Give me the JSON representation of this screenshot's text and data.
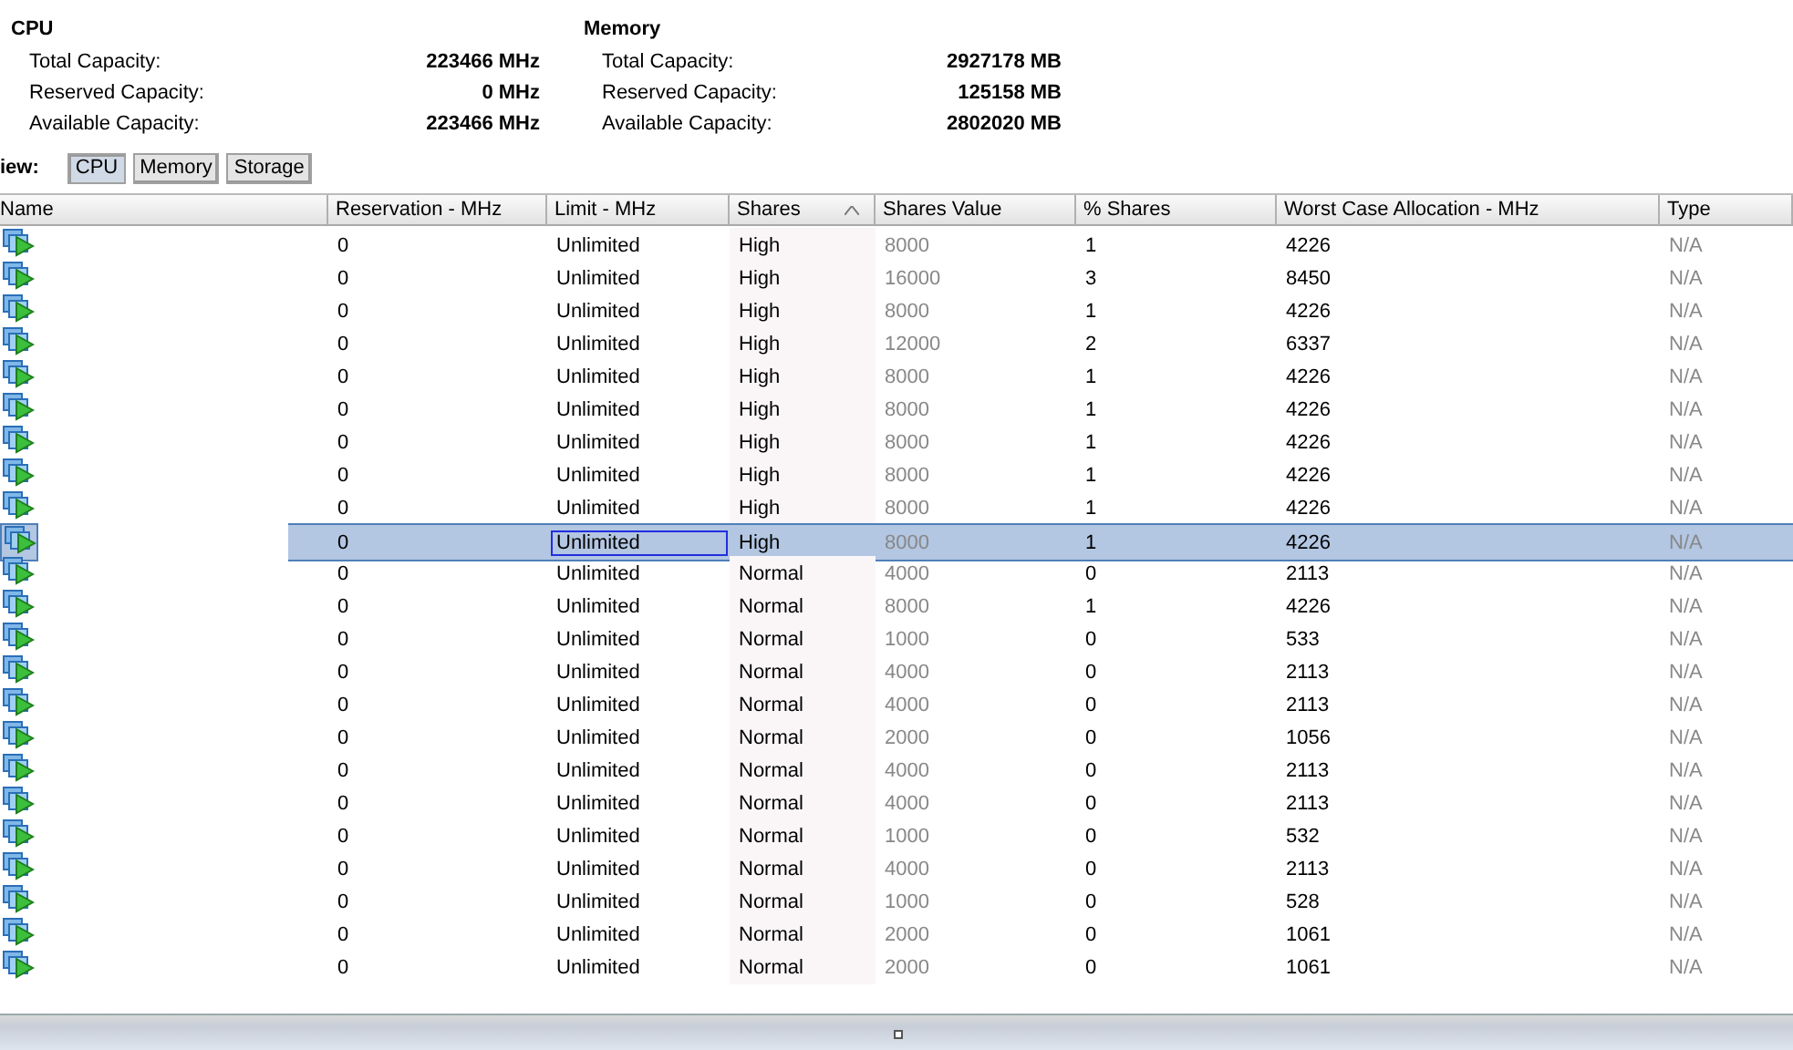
{
  "cpu": {
    "title": "CPU",
    "rows": [
      {
        "label": "Total Capacity:",
        "value": "223466 MHz"
      },
      {
        "label": "Reserved Capacity:",
        "value": "0 MHz"
      },
      {
        "label": "Available Capacity:",
        "value": "223466 MHz"
      }
    ]
  },
  "memory": {
    "title": "Memory",
    "rows": [
      {
        "label": "Total Capacity:",
        "value": "2927178 MB"
      },
      {
        "label": "Reserved Capacity:",
        "value": "125158 MB"
      },
      {
        "label": "Available Capacity:",
        "value": "2802020 MB"
      }
    ]
  },
  "view": {
    "label": "iew:",
    "buttons": [
      {
        "label": "CPU",
        "selected": true
      },
      {
        "label": "Memory",
        "selected": false
      },
      {
        "label": "Storage",
        "selected": false
      }
    ]
  },
  "table": {
    "columns": [
      {
        "label": "Name",
        "sorted": false
      },
      {
        "label": "Reservation - MHz",
        "sorted": false
      },
      {
        "label": "Limit - MHz",
        "sorted": false
      },
      {
        "label": "Shares",
        "sorted": true
      },
      {
        "label": "Shares Value",
        "sorted": false
      },
      {
        "label": "% Shares",
        "sorted": false
      },
      {
        "label": "Worst Case Allocation - MHz",
        "sorted": false
      },
      {
        "label": "Type",
        "sorted": false
      }
    ],
    "rows": [
      {
        "reservation": "0",
        "limit": "Unlimited",
        "shares": "High",
        "shares_value": "8000",
        "percent_shares": "1",
        "worst_case": "4226",
        "type": "N/A",
        "selected": false
      },
      {
        "reservation": "0",
        "limit": "Unlimited",
        "shares": "High",
        "shares_value": "16000",
        "percent_shares": "3",
        "worst_case": "8450",
        "type": "N/A",
        "selected": false
      },
      {
        "reservation": "0",
        "limit": "Unlimited",
        "shares": "High",
        "shares_value": "8000",
        "percent_shares": "1",
        "worst_case": "4226",
        "type": "N/A",
        "selected": false
      },
      {
        "reservation": "0",
        "limit": "Unlimited",
        "shares": "High",
        "shares_value": "12000",
        "percent_shares": "2",
        "worst_case": "6337",
        "type": "N/A",
        "selected": false
      },
      {
        "reservation": "0",
        "limit": "Unlimited",
        "shares": "High",
        "shares_value": "8000",
        "percent_shares": "1",
        "worst_case": "4226",
        "type": "N/A",
        "selected": false
      },
      {
        "reservation": "0",
        "limit": "Unlimited",
        "shares": "High",
        "shares_value": "8000",
        "percent_shares": "1",
        "worst_case": "4226",
        "type": "N/A",
        "selected": false
      },
      {
        "reservation": "0",
        "limit": "Unlimited",
        "shares": "High",
        "shares_value": "8000",
        "percent_shares": "1",
        "worst_case": "4226",
        "type": "N/A",
        "selected": false
      },
      {
        "reservation": "0",
        "limit": "Unlimited",
        "shares": "High",
        "shares_value": "8000",
        "percent_shares": "1",
        "worst_case": "4226",
        "type": "N/A",
        "selected": false
      },
      {
        "reservation": "0",
        "limit": "Unlimited",
        "shares": "High",
        "shares_value": "8000",
        "percent_shares": "1",
        "worst_case": "4226",
        "type": "N/A",
        "selected": false
      },
      {
        "reservation": "0",
        "limit": "Unlimited",
        "shares": "High",
        "shares_value": "8000",
        "percent_shares": "1",
        "worst_case": "4226",
        "type": "N/A",
        "selected": true
      },
      {
        "reservation": "0",
        "limit": "Unlimited",
        "shares": "Normal",
        "shares_value": "4000",
        "percent_shares": "0",
        "worst_case": "2113",
        "type": "N/A",
        "selected": false
      },
      {
        "reservation": "0",
        "limit": "Unlimited",
        "shares": "Normal",
        "shares_value": "8000",
        "percent_shares": "1",
        "worst_case": "4226",
        "type": "N/A",
        "selected": false
      },
      {
        "reservation": "0",
        "limit": "Unlimited",
        "shares": "Normal",
        "shares_value": "1000",
        "percent_shares": "0",
        "worst_case": "533",
        "type": "N/A",
        "selected": false
      },
      {
        "reservation": "0",
        "limit": "Unlimited",
        "shares": "Normal",
        "shares_value": "4000",
        "percent_shares": "0",
        "worst_case": "2113",
        "type": "N/A",
        "selected": false
      },
      {
        "reservation": "0",
        "limit": "Unlimited",
        "shares": "Normal",
        "shares_value": "4000",
        "percent_shares": "0",
        "worst_case": "2113",
        "type": "N/A",
        "selected": false
      },
      {
        "reservation": "0",
        "limit": "Unlimited",
        "shares": "Normal",
        "shares_value": "2000",
        "percent_shares": "0",
        "worst_case": "1056",
        "type": "N/A",
        "selected": false
      },
      {
        "reservation": "0",
        "limit": "Unlimited",
        "shares": "Normal",
        "shares_value": "4000",
        "percent_shares": "0",
        "worst_case": "2113",
        "type": "N/A",
        "selected": false
      },
      {
        "reservation": "0",
        "limit": "Unlimited",
        "shares": "Normal",
        "shares_value": "4000",
        "percent_shares": "0",
        "worst_case": "2113",
        "type": "N/A",
        "selected": false
      },
      {
        "reservation": "0",
        "limit": "Unlimited",
        "shares": "Normal",
        "shares_value": "1000",
        "percent_shares": "0",
        "worst_case": "532",
        "type": "N/A",
        "selected": false
      },
      {
        "reservation": "0",
        "limit": "Unlimited",
        "shares": "Normal",
        "shares_value": "4000",
        "percent_shares": "0",
        "worst_case": "2113",
        "type": "N/A",
        "selected": false
      },
      {
        "reservation": "0",
        "limit": "Unlimited",
        "shares": "Normal",
        "shares_value": "1000",
        "percent_shares": "0",
        "worst_case": "528",
        "type": "N/A",
        "selected": false
      },
      {
        "reservation": "0",
        "limit": "Unlimited",
        "shares": "Normal",
        "shares_value": "2000",
        "percent_shares": "0",
        "worst_case": "1061",
        "type": "N/A",
        "selected": false
      },
      {
        "reservation": "0",
        "limit": "Unlimited",
        "shares": "Normal",
        "shares_value": "2000",
        "percent_shares": "0",
        "worst_case": "1061",
        "type": "N/A",
        "selected": false
      }
    ]
  }
}
